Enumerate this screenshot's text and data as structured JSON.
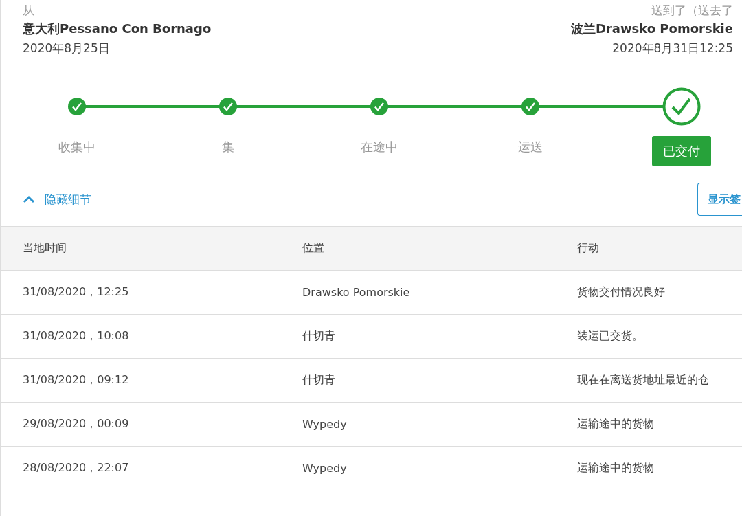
{
  "origin": {
    "label": "从",
    "place": "意大利Pessano Con Bornago",
    "date": "2020年8月25日"
  },
  "destination": {
    "label": "送到了（送去了",
    "place": "波兰Drawsko Pomorskie",
    "date": "2020年8月31日12:25"
  },
  "steps": [
    {
      "label": "收集中",
      "selected": false
    },
    {
      "label": "集",
      "selected": false
    },
    {
      "label": "在途中",
      "selected": false
    },
    {
      "label": "运送",
      "selected": false
    },
    {
      "label": "已交付",
      "selected": true
    }
  ],
  "details_toggle": {
    "label": "隐藏细节",
    "expanded": true
  },
  "signature_button": "显示签",
  "table": {
    "columns": [
      "当地时间",
      "位置",
      "行动"
    ],
    "rows": [
      [
        "31/08/2020，12:25",
        "Drawsko Pomorskie",
        "货物交付情况良好"
      ],
      [
        "31/08/2020，10:08",
        "什切青",
        "装运已交货。"
      ],
      [
        "31/08/2020，09:12",
        "什切青",
        "现在在离送货地址最近的仓"
      ],
      [
        "29/08/2020，00:09",
        "Wypedy",
        "运输途中的货物"
      ],
      [
        "28/08/2020，22:07",
        "Wypedy",
        "运输途中的货物"
      ]
    ]
  }
}
